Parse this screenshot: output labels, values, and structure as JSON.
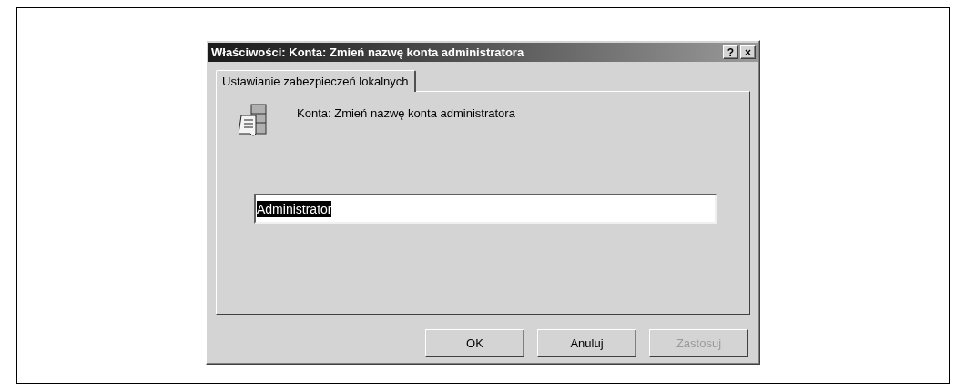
{
  "window": {
    "title": "Właściwości: Konta: Zmień nazwę konta administratora",
    "title_buttons": [
      "?",
      "×"
    ]
  },
  "tabs": [
    {
      "label": "Ustawianie zabezpieczeń lokalnych",
      "selected": true
    }
  ],
  "policy": {
    "name": "Konta: Zmień nazwę konta administratora"
  },
  "field": {
    "value": "Administrator",
    "selected": true
  },
  "buttons": [
    {
      "label": "OK",
      "disabled": false
    },
    {
      "label": "Anuluj",
      "disabled": false
    },
    {
      "label": "Zastosuj",
      "disabled": true
    }
  ]
}
